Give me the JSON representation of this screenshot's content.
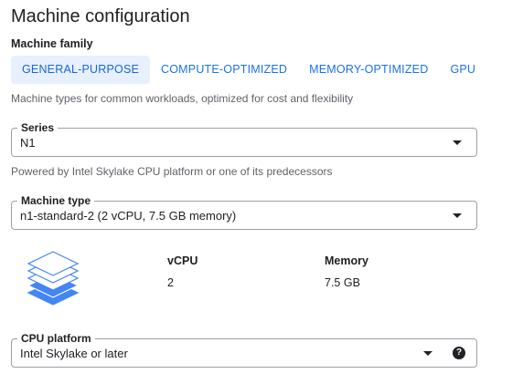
{
  "title": "Machine configuration",
  "machine_family": {
    "label": "Machine family",
    "tabs": [
      {
        "label": "GENERAL-PURPOSE",
        "selected": true
      },
      {
        "label": "COMPUTE-OPTIMIZED",
        "selected": false
      },
      {
        "label": "MEMORY-OPTIMIZED",
        "selected": false
      },
      {
        "label": "GPU",
        "selected": false
      }
    ],
    "description": "Machine types for common workloads, optimized for cost and flexibility"
  },
  "series": {
    "label": "Series",
    "value": "N1",
    "helper": "Powered by Intel Skylake CPU platform or one of its predecessors"
  },
  "machine_type": {
    "label": "Machine type",
    "value": "n1-standard-2 (2 vCPU, 7.5 GB memory)"
  },
  "specs": {
    "icon": "layers-stack-icon",
    "vcpu_label": "vCPU",
    "vcpu_value": "2",
    "memory_label": "Memory",
    "memory_value": "7.5 GB"
  },
  "cpu_platform": {
    "label": "CPU platform",
    "value": "Intel Skylake or later",
    "help_icon": "help-icon"
  },
  "colors": {
    "accent": "#1a73e8",
    "selected_tab_bg": "#e8f0fe",
    "border": "#9aa0a6",
    "helper_text": "#5f6368",
    "icon_blue": "#4285f4"
  }
}
